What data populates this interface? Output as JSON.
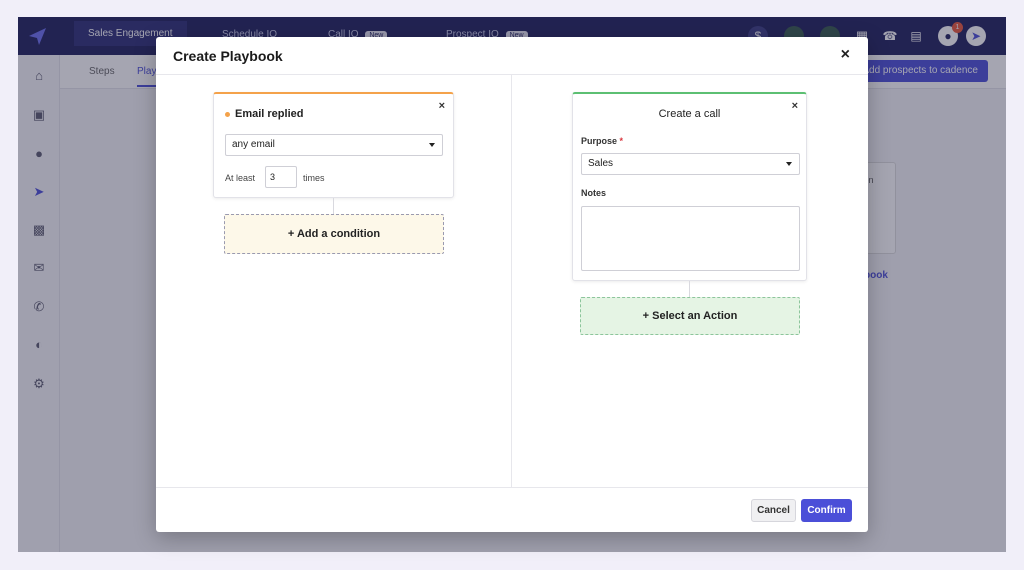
{
  "app": {
    "nav_tabs": [
      {
        "label": "Sales Engagement",
        "badge": ""
      },
      {
        "label": "Schedule IQ",
        "badge": ""
      },
      {
        "label": "Call IQ",
        "badge": "New"
      },
      {
        "label": "Prospect IQ",
        "badge": "New"
      }
    ],
    "notification_count": "1",
    "sub_tabs": [
      "Steps",
      "Playbooks"
    ],
    "add_prospects_label": "Add prospects to cadence",
    "bg_card_text": "ven",
    "bg_link_text": "book"
  },
  "modal": {
    "title": "Create Playbook",
    "close_label": "×",
    "trigger": {
      "title": "Email replied",
      "email_select": "any email",
      "at_least_label": "At least",
      "count": "3",
      "times_label": "times"
    },
    "add_condition_label": "+ Add a condition",
    "action": {
      "title": "Create a call",
      "purpose_label": "Purpose",
      "required_mark": "*",
      "purpose_value": "Sales",
      "notes_label": "Notes",
      "notes_value": ""
    },
    "select_action_label": "+ Select an Action",
    "cancel_label": "Cancel",
    "confirm_label": "Confirm"
  },
  "colors": {
    "brand": "#4b4fd8",
    "topbar": "#1e1f5c",
    "trigger_accent": "#f4a24a",
    "action_accent": "#5cbf72"
  }
}
